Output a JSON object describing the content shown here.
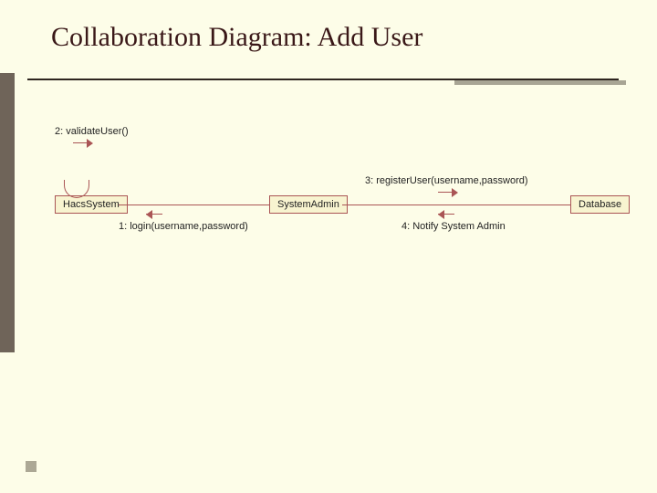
{
  "title": "Collaboration Diagram: Add User",
  "objects": {
    "hacs": "HacsSystem",
    "admin": "SystemAdmin",
    "db": "Database"
  },
  "messages": {
    "m1": "1: login(username,password)",
    "m2": "2: validateUser()",
    "m3": "3: registerUser(username,password)",
    "m4": "4: Notify System Admin"
  }
}
